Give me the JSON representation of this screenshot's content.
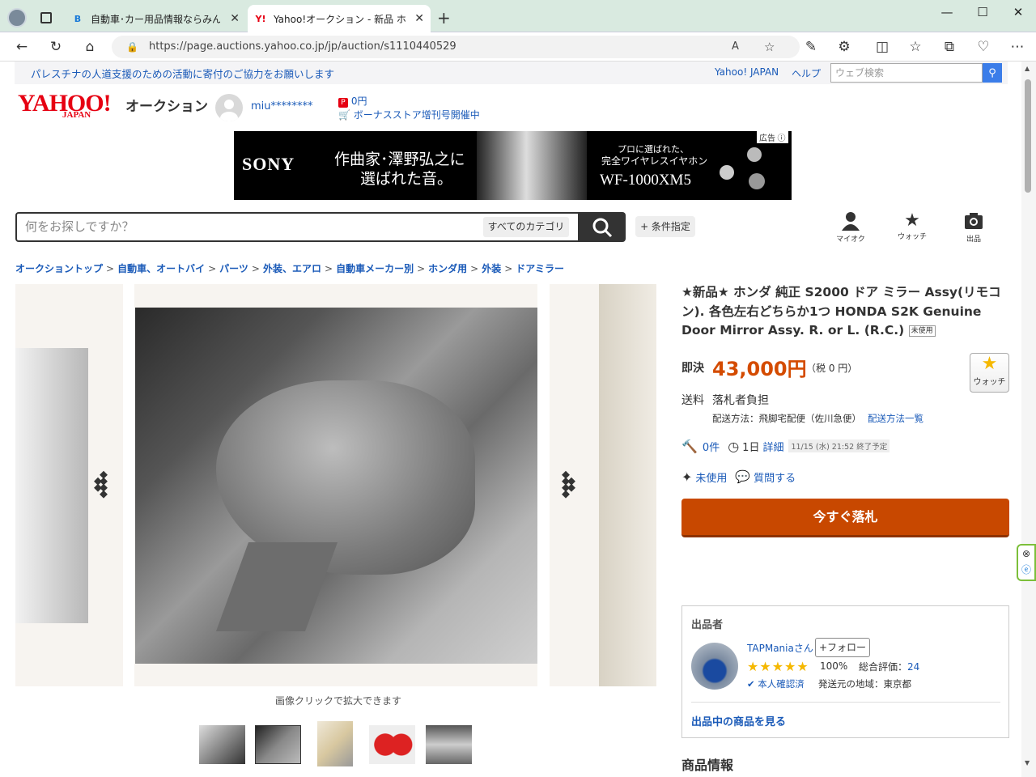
{
  "browser": {
    "tabs": [
      {
        "title": "自動車･カー用品情報ならみんカラ"
      },
      {
        "title": "Yahoo!オークション - 新品 ホンダ 純正"
      }
    ],
    "url": "https://page.auctions.yahoo.co.jp/jp/auction/s1110440529"
  },
  "notice": {
    "text": "パレスチナの人道支援のための活動に寄付のご協力をお願いします",
    "links": [
      "Yahoo! JAPAN",
      "ヘルプ"
    ],
    "search_placeholder": "ウェブ検索"
  },
  "header": {
    "logo": "YAHOO!",
    "logo_sub": "JAPAN",
    "service": "オークション",
    "user": "miu********",
    "points": "0円",
    "campaign": "ボーナスストア增刊号開催中"
  },
  "ad": {
    "brand": "SONY",
    "line1": "作曲家･澤野弘之に",
    "line2": "選ばれた音。",
    "tag1": "プロに選ばれた、",
    "tag2": "完全ワイヤレスイヤホン",
    "model": "WF-1000XM5",
    "ad_label": "広告"
  },
  "search": {
    "placeholder": "何をお探しですか？",
    "category": "すべてのカテゴリ",
    "condition": "+ 条件指定"
  },
  "header_icons": [
    "マイオク",
    "ウォッチ",
    "出品"
  ],
  "breadcrumb": [
    "オークショントップ",
    "自動車、オートバイ",
    "パーツ",
    "外装、エアロ",
    "自動車メーカー別",
    "ホンダ用",
    "外装",
    "ドアミラー"
  ],
  "gallery": {
    "caption": "画像クリックで拡大できます"
  },
  "item": {
    "title": "★新品★ ホンダ 純正 S2000 ドア ミラー Assy(リモコン). 各色左右どちらか1つ HONDA S2K Genuine Door Mirror Assy. R. or L. (R.C.)",
    "condition_tag": "未使用",
    "price_label": "即決",
    "price": "43,000円",
    "tax": "（税 0 円）",
    "watch": "ウォッチ",
    "shipping_label": "送料",
    "shipping_value": "落札者負担",
    "ship_method": "配送方法：飛脚宅配便（佐川急便）",
    "ship_link": "配送方法一覧",
    "bids": "0件",
    "time_left": "1日",
    "detail": "詳細",
    "end_time": "11/15 (水) 21:52 終了予定",
    "condition": "未使用",
    "question": "質問する",
    "buy_now": "今すぐ落札"
  },
  "seller": {
    "heading": "出品者",
    "name": "TAPManiaさん",
    "follow": "+フォロー",
    "rating_pct": "100%",
    "total_label": "総合評価：",
    "total": "24",
    "verified": "本人確認済",
    "region": "発送元の地域：東京都",
    "items_link": "出品中の商品を見る",
    "stars": 5
  },
  "product_info": "商品情報",
  "colors": {
    "accent": "#c84800",
    "link": "#1a5ab8",
    "price": "#d44b00"
  }
}
